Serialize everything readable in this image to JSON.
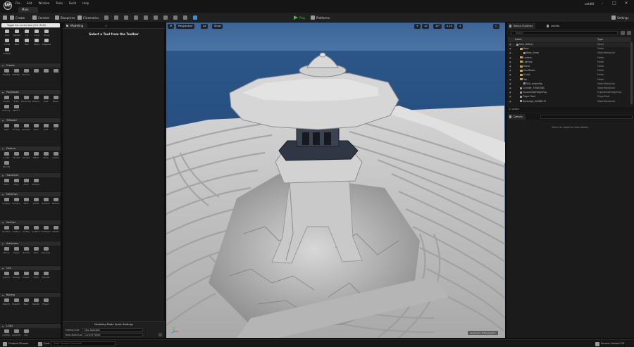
{
  "titlebar": {
    "logo": "UE",
    "menu": [
      "File",
      "Edit",
      "Window",
      "Tools",
      "Build",
      "Help"
    ],
    "level_tab": "Main",
    "project": "untitld",
    "window_controls": [
      "–",
      "□",
      "✕"
    ]
  },
  "toolbar": {
    "create": "Create",
    "content": "Content",
    "blueprints": "Blueprints",
    "cinematics": "Cinematics",
    "play": "Play",
    "platforms": "Platforms",
    "settings": "Settings"
  },
  "modes_panel": {
    "tooltip": "Toggle the current tool (Ctrl+Shift)",
    "modes": [
      "Box",
      "Sphere",
      "Cyl",
      "Cone",
      "Torus",
      "Arrow",
      "Rect",
      "Disc",
      "Stairs",
      "Capsule",
      "Drawer"
    ],
    "categories": [
      {
        "name": "Create",
        "tools": [
          "PolyExt",
          "PathExt",
          "Revolve",
          "",
          "",
          ""
        ]
      },
      {
        "name": "PolyModel",
        "tools": [
          "PolyEd",
          "TriSel",
          "PolyGroup",
          "Deform",
          "Inset",
          "Bevel",
          "Extrude",
          "Pattern"
        ]
      },
      {
        "name": "TriModel",
        "tools": [
          "TriEd",
          "Simplify",
          "Remesh",
          "Weld",
          "Inset",
          "Fill"
        ]
      },
      {
        "name": "Deform",
        "tools": [
          "Sculpt",
          "VSculpt",
          "Smooth",
          "Offset",
          "Warp",
          "Lattice",
          "DfrmPS"
        ]
      },
      {
        "name": "Transform",
        "tools": [
          "Xform",
          "Align",
          "Pivot",
          "PlcPivot"
        ]
      },
      {
        "name": "MeshOps",
        "tools": [
          "Simplify",
          "Remesh",
          "Weld",
          "Jacket",
          "Boolean",
          "MshCut"
        ]
      },
      {
        "name": "VoxOps",
        "tools": [
          "VoxWrap",
          "VoxBool",
          "VoxMrg",
          "VoxBlnd",
          "VoxMorph",
          "MshFill"
        ]
      },
      {
        "name": "Attributes",
        "tools": [
          "Norms",
          "Tngnts",
          "Normls",
          "Attrs",
          "PolyGrps"
        ]
      },
      {
        "name": "UVs",
        "tools": [
          "AutoUV",
          "Unwrap",
          "Project",
          "UVEd",
          "Transfer"
        ]
      },
      {
        "name": "Baking",
        "tools": [
          "BakeTx",
          "BakeVtx",
          "Bake",
          "BakeRC",
          "Export"
        ]
      },
      {
        "name": "LODs",
        "tools": [
          "LODMgr",
          "AutoLOD",
          "Xfer"
        ]
      }
    ]
  },
  "modeling_panel": {
    "tab": "Modeling",
    "empty_message": "Select a Tool from the Toolbar",
    "quick_settings_title": "Modeling Mode Quick Settings",
    "editing_lod_label": "Editing LOD",
    "editing_lod_value": "Max Available",
    "new_asset_label": "New Asset Location",
    "new_asset_value": "Current Folder"
  },
  "viewport": {
    "buttons": [
      "☰",
      "Perspective",
      "Lit",
      "Show"
    ],
    "right_buttons": [
      "✛",
      "10",
      "10°",
      "0.25",
      "4"
    ],
    "overlay": "Level grid: Orthographic"
  },
  "outliner": {
    "tab": "World Outliner",
    "levels_tab": "Levels",
    "search_placeholder": "Search",
    "header_label": "Label",
    "header_type": "Type",
    "rows": [
      {
        "label": "Main (Editor)",
        "type": "World",
        "indent": 0,
        "kind": "world"
      },
      {
        "label": "Base",
        "type": "Folder",
        "indent": 1,
        "kind": "folder"
      },
      {
        "label": "Base_Grass",
        "type": "StaticMeshActor",
        "indent": 2,
        "kind": "actor"
      },
      {
        "label": "Lantern",
        "type": "Folder",
        "indent": 1,
        "kind": "folder"
      },
      {
        "label": "Lighting",
        "type": "Folder",
        "indent": 1,
        "kind": "folder"
      },
      {
        "label": "Rocks",
        "type": "Folder",
        "indent": 1,
        "kind": "folder"
      },
      {
        "label": "SandRocks",
        "type": "Folder",
        "indent": 1,
        "kind": "folder"
      },
      {
        "label": "Sculpt",
        "type": "Folder",
        "indent": 1,
        "kind": "folder"
      },
      {
        "label": "Top",
        "type": "Folder",
        "indent": 1,
        "kind": "folder"
      },
      {
        "label": "SM_LanternTop",
        "type": "StaticMeshActor",
        "indent": 2,
        "kind": "actor"
      },
      {
        "label": "Cylinder_7958D36D",
        "type": "StaticMeshActor",
        "indent": 1,
        "kind": "actor"
      },
      {
        "label": "ExponentialHeightFog",
        "type": "ExponentialHeightFog",
        "indent": 1,
        "kind": "actor"
      },
      {
        "label": "Player Start",
        "type": "PlayerStart",
        "indent": 1,
        "kind": "actor"
      },
      {
        "label": "Rectangle_9A38BC72",
        "type": "StaticMeshActor",
        "indent": 1,
        "kind": "actor"
      }
    ],
    "footer": "17 actors"
  },
  "details": {
    "tab": "Details",
    "empty_message": "Select an object to view details."
  },
  "statusbar": {
    "content_drawer": "Content Drawer",
    "cmd": "Cmd",
    "console_placeholder": "Enter Console Command",
    "source_control": "Source Control Off"
  },
  "colors": {
    "sky": "#3a5f8c",
    "sea": "#315a88",
    "sand": "#bdbdbd",
    "play_green": "#3fbf3f",
    "folder": "#c9a34a"
  }
}
